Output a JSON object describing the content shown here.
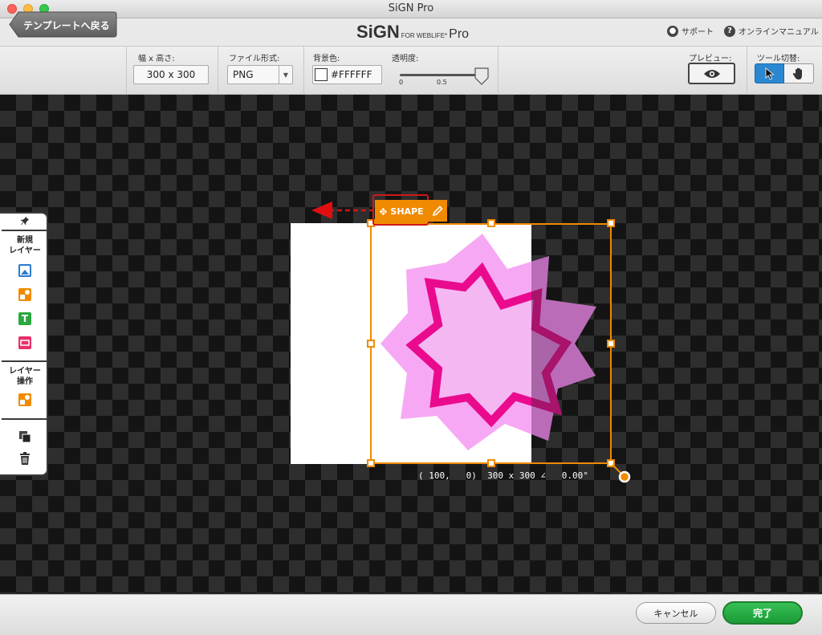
{
  "window": {
    "title": "SiGN Pro"
  },
  "brand": {
    "name": "SiGN",
    "sub": "FOR WEBLIFE*",
    "suffix": "Pro"
  },
  "header": {
    "support_label": "サポート",
    "manual_label": "オンラインマニュアル"
  },
  "toolbar": {
    "back_label": "テンプレートへ戻る",
    "size_label": "幅 x 高さ:",
    "size_value": "300 x 300",
    "format_label": "ファイル形式:",
    "format_value": "PNG",
    "bgcolor_label": "背景色:",
    "bgcolor_value": "#FFFFFF",
    "opacity_label": "透明度:",
    "opacity_min": "0",
    "opacity_mid": "0.5",
    "opacity_value": 1.0,
    "preview_label": "プレビュー:",
    "tool_label": "ツール切替:"
  },
  "left_panel": {
    "new_layer_label": "新規\nレイヤー",
    "layer_ops_label": "レイヤー\n操作"
  },
  "selection": {
    "tag_label": "SHAPE",
    "info": "( 100,   0)  300 x 300 ∠   0.00°"
  },
  "footer": {
    "cancel_label": "キャンセル",
    "done_label": "完了"
  },
  "colors": {
    "accent": "#f08a00",
    "done": "#22a83f",
    "shape_light": "#f7a8f4",
    "shape_dark": "#ea0a8e",
    "tool_active": "#2a88d0"
  }
}
